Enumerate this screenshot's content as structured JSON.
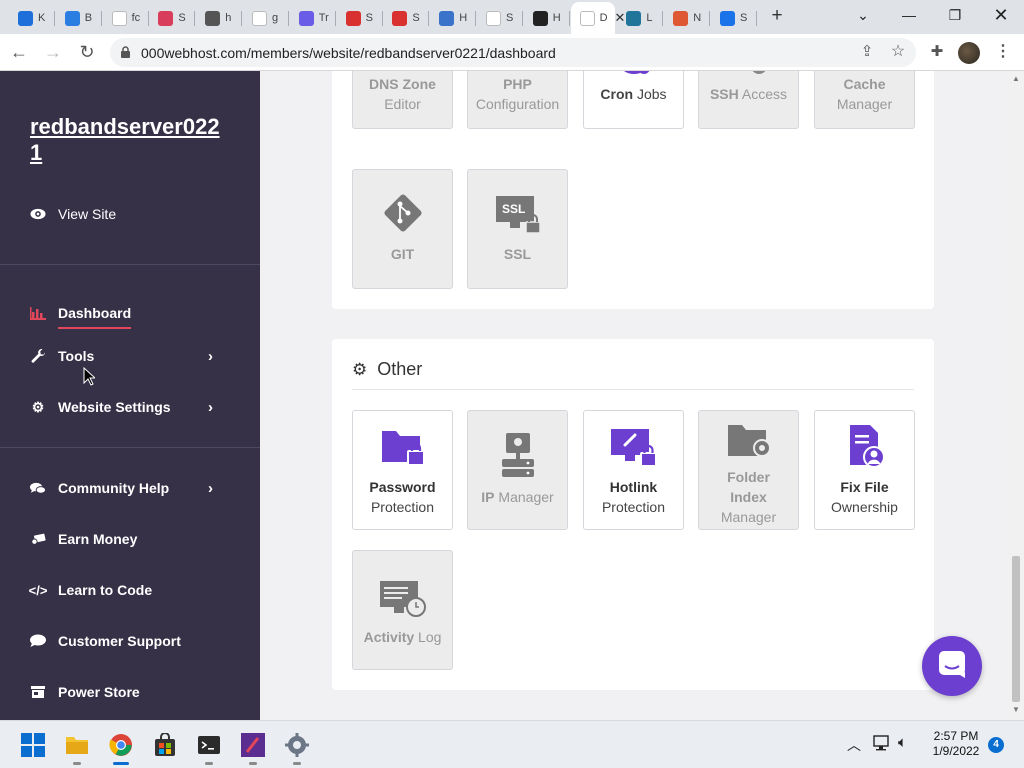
{
  "browser": {
    "tabs": [
      {
        "icon": "edge-icon",
        "label": "K",
        "color": "#1e6fd9"
      },
      {
        "icon": "app-icon",
        "label": "B",
        "color": "#2a7de1"
      },
      {
        "icon": "google-icon",
        "label": "fc",
        "color": "#ffffff"
      },
      {
        "icon": "puzzle-icon",
        "label": "S",
        "color": "#d93d5c"
      },
      {
        "icon": "globe-icon",
        "label": "h",
        "color": "#555555"
      },
      {
        "icon": "google-icon",
        "label": "g",
        "color": "#ffffff"
      },
      {
        "icon": "at-icon",
        "label": "Tr",
        "color": "#6b5ce7"
      },
      {
        "icon": "p-icon",
        "label": "S",
        "color": "#d93030"
      },
      {
        "icon": "p-icon",
        "label": "S",
        "color": "#d93030"
      },
      {
        "icon": "history-icon",
        "label": "H",
        "color": "#3a73c9"
      },
      {
        "icon": "google-icon",
        "label": "S",
        "color": "#ffffff"
      },
      {
        "icon": "warning-icon",
        "label": "H",
        "color": "#222222"
      },
      {
        "icon": "000webhost-icon",
        "label": "D",
        "color": "#ffffff",
        "active": true
      },
      {
        "icon": "wordpress-icon",
        "label": "L",
        "color": "#21759b"
      },
      {
        "icon": "duck-icon",
        "label": "N",
        "color": "#de5833"
      },
      {
        "icon": "gear-icon",
        "label": "S",
        "color": "#1a73e8"
      }
    ],
    "new_tab": "+",
    "url": "000webhost.com/members/website/redbandserver0221/dashboard"
  },
  "sidebar": {
    "site_name": "redbandserver0221",
    "view_site": "View Site",
    "items": [
      {
        "label": "Dashboard",
        "icon": "bar-chart-icon",
        "active": true
      },
      {
        "label": "Tools",
        "icon": "wrench-icon",
        "chevron": true
      },
      {
        "label": "Website Settings",
        "icon": "gear-icon",
        "chevron": true
      },
      {
        "label": "Community Help",
        "icon": "comments-icon",
        "chevron": true
      },
      {
        "label": "Earn Money",
        "icon": "money-icon"
      },
      {
        "label": "Learn to Code",
        "icon": "code-icon"
      },
      {
        "label": "Customer Support",
        "icon": "chat-icon"
      },
      {
        "label": "Power Store",
        "icon": "store-icon"
      }
    ]
  },
  "tools_panel": {
    "tiles_row1": [
      {
        "bold": "DNS Zone",
        "rest": "Editor",
        "disabled": true,
        "icon": "dns-icon"
      },
      {
        "bold": "PHP",
        "rest": "Configuration",
        "disabled": true,
        "icon": "php-icon"
      },
      {
        "bold": "Cron",
        "rest": " Jobs",
        "disabled": false,
        "icon": "clock-gear-icon"
      },
      {
        "bold": "SSH",
        "rest": " Access",
        "disabled": true,
        "icon": "ssh-icon"
      },
      {
        "bold": "Cache",
        "rest": "Manager",
        "disabled": true,
        "icon": "cache-icon"
      }
    ],
    "tiles_row2": [
      {
        "bold": "GIT",
        "rest": "",
        "disabled": true,
        "icon": "git-icon"
      },
      {
        "bold": "SSL",
        "rest": "",
        "disabled": true,
        "icon": "ssl-icon"
      }
    ]
  },
  "other_panel": {
    "title": "Other",
    "tiles": [
      {
        "bold": "Password",
        "rest": "Protection",
        "disabled": false,
        "icon": "folder-lock-icon"
      },
      {
        "bold": "IP",
        "rest": " Manager",
        "disabled": true,
        "icon": "ip-icon"
      },
      {
        "bold": "Hotlink",
        "rest": "Protection",
        "disabled": false,
        "icon": "link-lock-icon"
      },
      {
        "bold": "Folder Index",
        "rest": "Manager",
        "disabled": true,
        "icon": "folder-gear-icon"
      },
      {
        "bold": "Fix File",
        "rest": "Ownership",
        "disabled": false,
        "icon": "file-user-icon"
      },
      {
        "bold": "Activity",
        "rest": " Log",
        "disabled": true,
        "icon": "log-icon"
      }
    ]
  },
  "taskbar": {
    "time": "2:57 PM",
    "date": "1/9/2022",
    "notifications": "4"
  },
  "colors": {
    "sidebar_bg": "#363147",
    "accent_purple": "#6c3fd1",
    "active_red": "#e0475b"
  }
}
